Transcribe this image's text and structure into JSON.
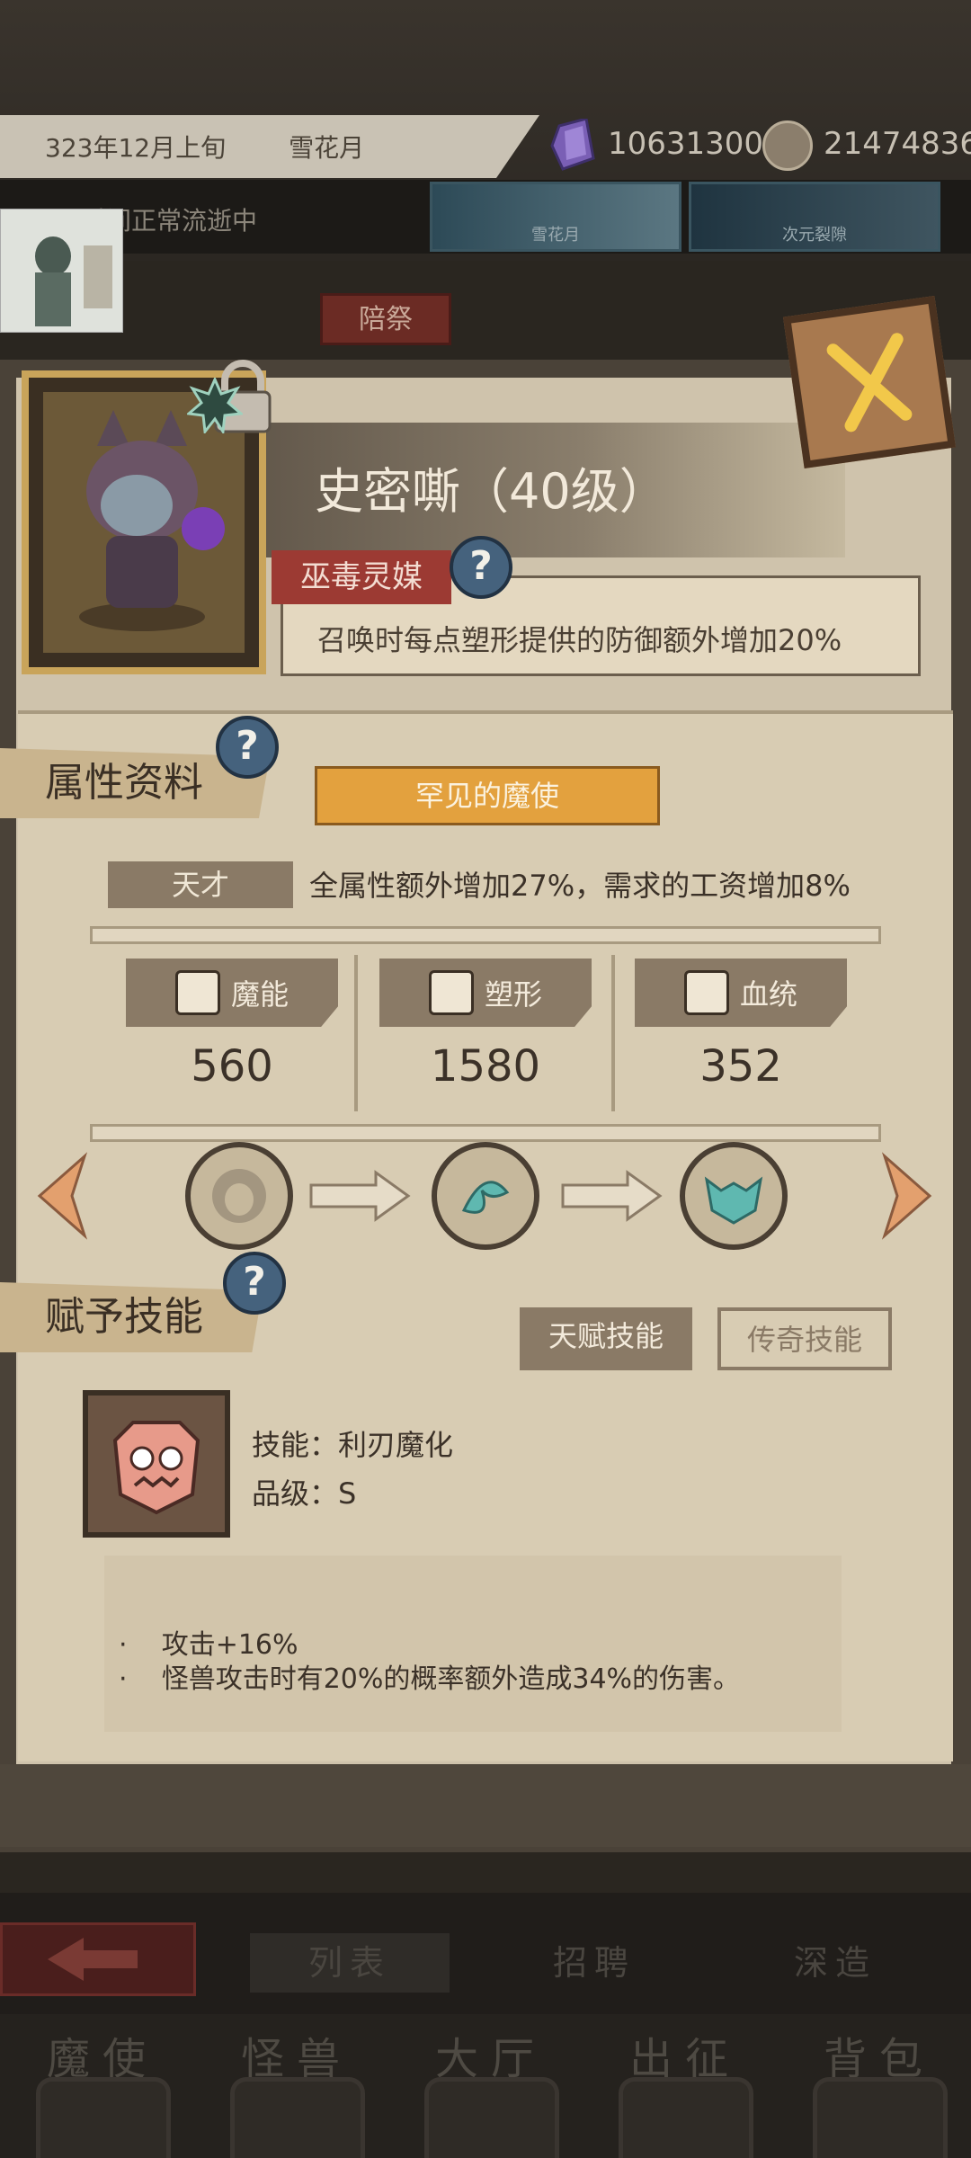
{
  "top_bar": {
    "date": "323年12月上旬",
    "month_name": "雪花月",
    "crystal_amount": "106313000",
    "coin_amount": "21474836",
    "time_status": "时间正常流逝中",
    "event_cards": [
      "雪花月",
      "次元裂隙"
    ],
    "peiji_label": "陪祭"
  },
  "character": {
    "name": "史密嘶（40级）",
    "trait_name": "巫毒灵媒",
    "trait_desc": "召唤时每点塑形提供的防御额外增加20%",
    "help_symbol": "?"
  },
  "attributes": {
    "section_title": "属性资料",
    "rarity": "罕见的魔使",
    "talent_label": "天才",
    "talent_desc": "全属性额外增加27%，需求的工资增加8%",
    "stats": [
      {
        "name": "魔能",
        "value": "560"
      },
      {
        "name": "塑形",
        "value": "1580"
      },
      {
        "name": "血统",
        "value": "352"
      }
    ]
  },
  "skills": {
    "section_title": "赋予技能",
    "talent_skill_tab": "天赋技能",
    "legend_skill_tab": "传奇技能",
    "skill_name": "技能：利刃魔化",
    "skill_grade": "品级：S",
    "effects": [
      "攻击+16%",
      "怪兽攻击时有20%的概率额外造成34%的伤害。"
    ],
    "bullet": "·"
  },
  "subnav": {
    "tabs": [
      "列表",
      "招聘",
      "深造"
    ]
  },
  "mainnav": {
    "items": [
      "魔使",
      "怪兽",
      "大厅",
      "出征",
      "背包"
    ]
  },
  "colors": {
    "panel": "#cfc3ac",
    "accent_orange": "#e3a13e",
    "trait_red": "#9c3a33",
    "help_blue": "#45627d",
    "tag_brown": "#8a7a66"
  }
}
